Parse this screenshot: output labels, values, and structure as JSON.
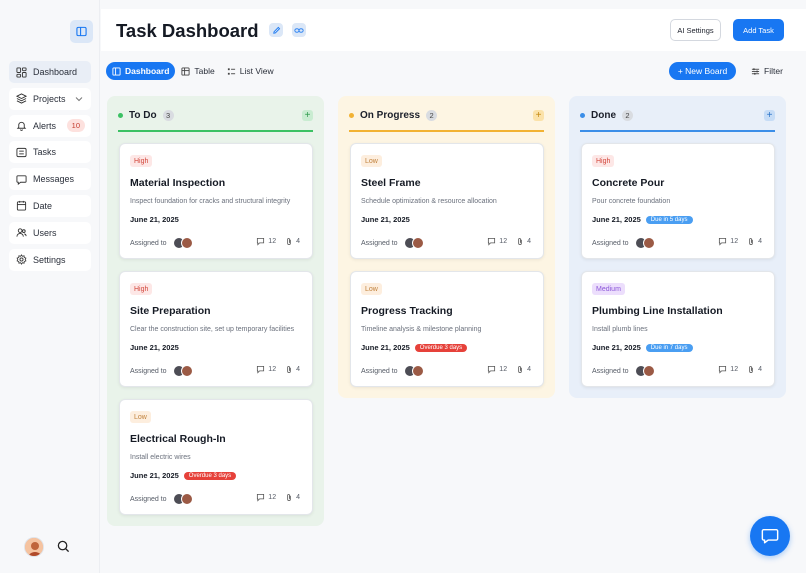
{
  "header": {
    "title": "Task Dashboard",
    "ai_settings_label": "AI Settings",
    "add_task_label": "Add Task"
  },
  "sidebar": {
    "items": [
      {
        "label": "Dashboard",
        "icon": "grid-icon"
      },
      {
        "label": "Projects",
        "icon": "layers-icon"
      },
      {
        "label": "Alerts",
        "icon": "bell-icon",
        "badge": "10"
      },
      {
        "label": "Tasks",
        "icon": "checklist-icon"
      },
      {
        "label": "Messages",
        "icon": "chat-icon"
      },
      {
        "label": "Date",
        "icon": "calendar-icon"
      },
      {
        "label": "Users",
        "icon": "users-icon"
      },
      {
        "label": "Settings",
        "icon": "gear-icon"
      }
    ]
  },
  "tabs": {
    "dashboard": "Dashboard",
    "table": "Table",
    "list_view": "List View"
  },
  "toolbar": {
    "new_board_label": "+ New Board",
    "filter_label": "Filter"
  },
  "columns": [
    {
      "title": "To Do",
      "count": "3",
      "color": "#3cc164",
      "cards": [
        {
          "priority": "High",
          "title": "Material Inspection",
          "desc": "Inspect foundation for cracks and structural integrity",
          "date": "June 21, 2025",
          "pill": "",
          "assigned": "Assigned to",
          "comments": "12",
          "attachments": "4"
        },
        {
          "priority": "High",
          "title": "Site Preparation",
          "desc": "Clear the construction site, set up temporary facilities",
          "date": "June 21, 2025",
          "pill": "",
          "assigned": "Assigned to",
          "comments": "12",
          "attachments": "4"
        },
        {
          "priority": "Low",
          "title": "Electrical Rough-In",
          "desc": "Install electric wires",
          "date": "June 21, 2025",
          "pill": "Overdue 3 days",
          "assigned": "Assigned to",
          "comments": "12",
          "attachments": "4"
        }
      ]
    },
    {
      "title": "On Progress",
      "count": "2",
      "color": "#f2b233",
      "cards": [
        {
          "priority": "Low",
          "title": "Steel Frame",
          "desc": "Schedule optimization & resource allocation",
          "date": "June 21, 2025",
          "pill": "",
          "assigned": "Assigned to",
          "comments": "12",
          "attachments": "4"
        },
        {
          "priority": "Low",
          "title": "Progress Tracking",
          "desc": "Timeline analysis & milestone planning",
          "date": "June 21, 2025",
          "pill": "Overdue 3 days",
          "assigned": "Assigned to",
          "comments": "12",
          "attachments": "4"
        }
      ]
    },
    {
      "title": "Done",
      "count": "2",
      "color": "#3b8ee8",
      "cards": [
        {
          "priority": "High",
          "title": "Concrete Pour",
          "desc": "Pour concrete foundation",
          "date": "June 21, 2025",
          "pill": "Due in 5 days",
          "assigned": "Assigned to",
          "comments": "12",
          "attachments": "4"
        },
        {
          "priority": "Medium",
          "title": "Plumbing Line Installation",
          "desc": "Install plumb lines",
          "date": "June 21, 2025",
          "pill": "Due in 7 days",
          "assigned": "Assigned to",
          "comments": "12",
          "attachments": "4"
        }
      ]
    }
  ]
}
